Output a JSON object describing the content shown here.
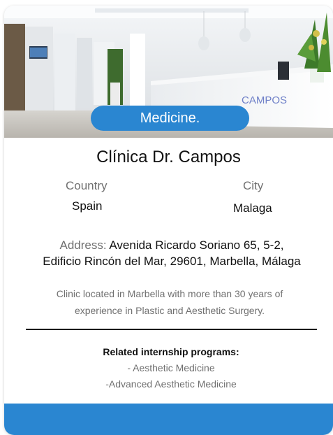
{
  "colors": {
    "accent": "#2a86d1",
    "footer": "#2a86d1",
    "label_gray": "#707070",
    "text_dark": "#111111"
  },
  "image": {
    "name": "clinic-reception-photo",
    "sign_text": "CAMPOS"
  },
  "badge": {
    "label": "Medicine."
  },
  "clinic": {
    "name": "Clínica Dr. Campos",
    "country_label": "Country",
    "country": "Spain",
    "city_label": "City",
    "city": "Malaga",
    "address_label": "Address:",
    "address_line1": "Avenida Ricardo Soriano 65, 5-2,",
    "address_line2": "Edificio Rincón del Mar, 29601, Marbella, Málaga",
    "description_line1": "Clinic located in Marbella with more than 30 years of",
    "description_line2": "experience in Plastic and Aesthetic Surgery."
  },
  "related": {
    "title": "Related internship programs:",
    "items": [
      "- Aesthetic Medicine",
      "-Advanced Aesthetic Medicine"
    ]
  }
}
